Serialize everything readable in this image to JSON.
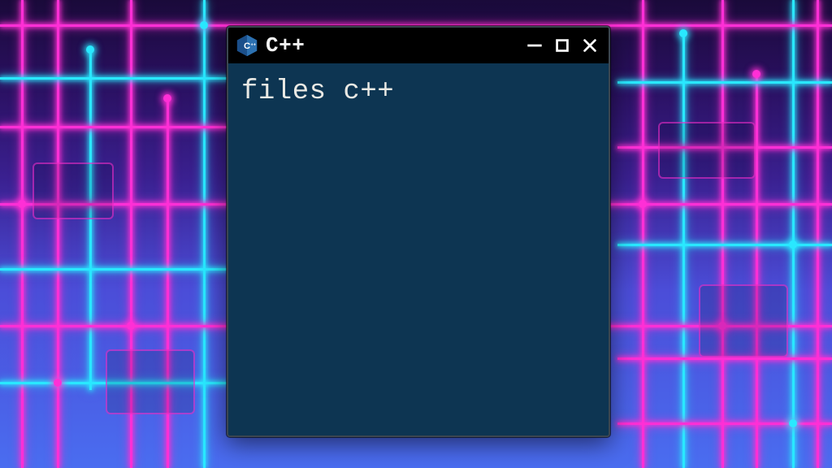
{
  "window": {
    "title": "C++",
    "icon_name": "cpp-icon"
  },
  "content": {
    "line1": "files c++"
  },
  "colors": {
    "window_bg": "#0d3552",
    "titlebar_bg": "#000000",
    "neon_pink": "#ff2fd6",
    "neon_cyan": "#29e8ff"
  }
}
